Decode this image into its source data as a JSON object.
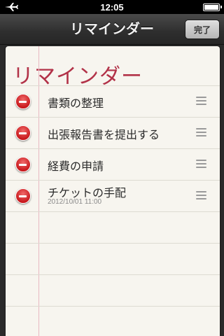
{
  "status_bar": {
    "time": "12:05",
    "airplane_icon": "airplane-icon",
    "battery_icon": "battery-icon"
  },
  "nav": {
    "title": "リマインダー",
    "done_label": "完了"
  },
  "paper": {
    "title": "リマインダー"
  },
  "reminders": [
    {
      "title": "書類の整理",
      "subtitle": ""
    },
    {
      "title": "出張報告書を提出する",
      "subtitle": ""
    },
    {
      "title": "経費の申請",
      "subtitle": ""
    },
    {
      "title": "チケットの手配",
      "subtitle": "2012/10/01 11:00"
    }
  ],
  "colors": {
    "title_red": "#b23248",
    "delete_red": "#c8181c",
    "paper": "#f7f5ef"
  }
}
